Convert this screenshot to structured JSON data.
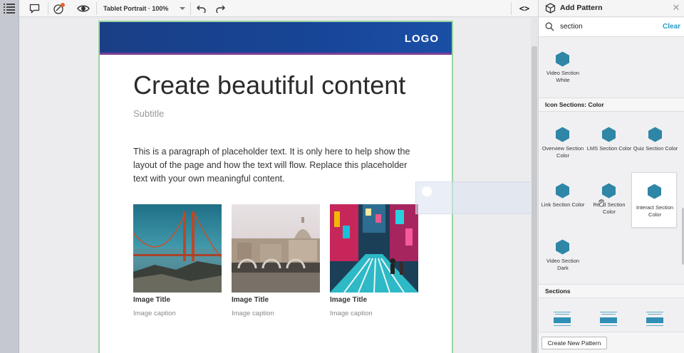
{
  "toolbar": {
    "device": "Tablet Portrait · 100%",
    "code_toggle": "<>"
  },
  "page": {
    "logo": "LOGO",
    "title": "Create beautiful content",
    "subtitle": "Subtitle",
    "paragraph": "This is a paragraph of placeholder text. It is only here to help show the layout of the page and how the text will flow. Replace this placeholder text with your own meaningful content.",
    "cards": [
      {
        "title": "Image Title",
        "caption": "Image caption",
        "image": "golden-gate-bridge-photo"
      },
      {
        "title": "Image Title",
        "caption": "Image caption",
        "image": "rome-cityscape-photo"
      },
      {
        "title": "Image Title",
        "caption": "Image caption",
        "image": "neon-street-photo"
      }
    ]
  },
  "panel": {
    "title": "Add Pattern",
    "search_value": "section",
    "clear_label": "Clear",
    "groups": [
      {
        "label": "",
        "items": [
          {
            "label": "Video Section White"
          }
        ]
      },
      {
        "label": "Icon Sections: Color",
        "items": [
          {
            "label": "Overview Section Color"
          },
          {
            "label": "LMS Section Color"
          },
          {
            "label": "Quiz Section Color"
          },
          {
            "label": "Link Section Color"
          },
          {
            "label": "Read Section Color"
          },
          {
            "label": "Interact Section Color",
            "selected": true
          },
          {
            "label": "Video Section Dark"
          }
        ]
      },
      {
        "label": "Sections",
        "items": []
      }
    ],
    "create_button": "Create New Pattern"
  },
  "colors": {
    "accent": "#2a9cc2",
    "hex_icon": "#2f86a6",
    "banner": "#174597",
    "banner_stripe": "#7b3f9a",
    "page_outline": "#9ad3a3"
  }
}
